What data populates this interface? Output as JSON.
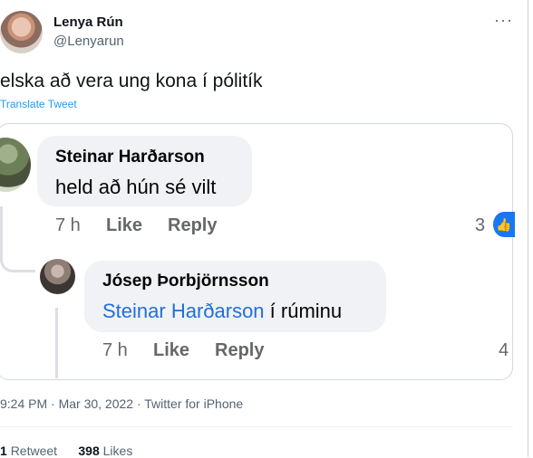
{
  "author": {
    "name": "Lenya Rún",
    "handle": "@Lenyarun"
  },
  "more_icon": "more-horizontal-icon",
  "tweet": {
    "text": "elska að vera ung kona í pólitík",
    "translate": "Translate Tweet"
  },
  "embedded_screenshot": {
    "comment1": {
      "name": "Steinar Harðarson",
      "text": "held að hún sé vilt",
      "time": "7 h",
      "like": "Like",
      "reply": "Reply",
      "reactions": "3"
    },
    "comment2": {
      "name": "Jósep Þorbjörnsson",
      "mention": "Steinar Harðarson",
      "text": " í rúminu",
      "time": "7 h",
      "like": "Like",
      "reply": "Reply",
      "reactions": "4"
    }
  },
  "timestamp": "9:24 PM · Mar 30, 2022 · Twitter for iPhone",
  "stats": {
    "retweets": "1",
    "retweets_label": "Retweet",
    "likes": "398",
    "likes_label": "Likes"
  },
  "colors": {
    "link": "#1d9bf0",
    "fb_blue": "#1877f2",
    "mention": "#216fdb"
  }
}
